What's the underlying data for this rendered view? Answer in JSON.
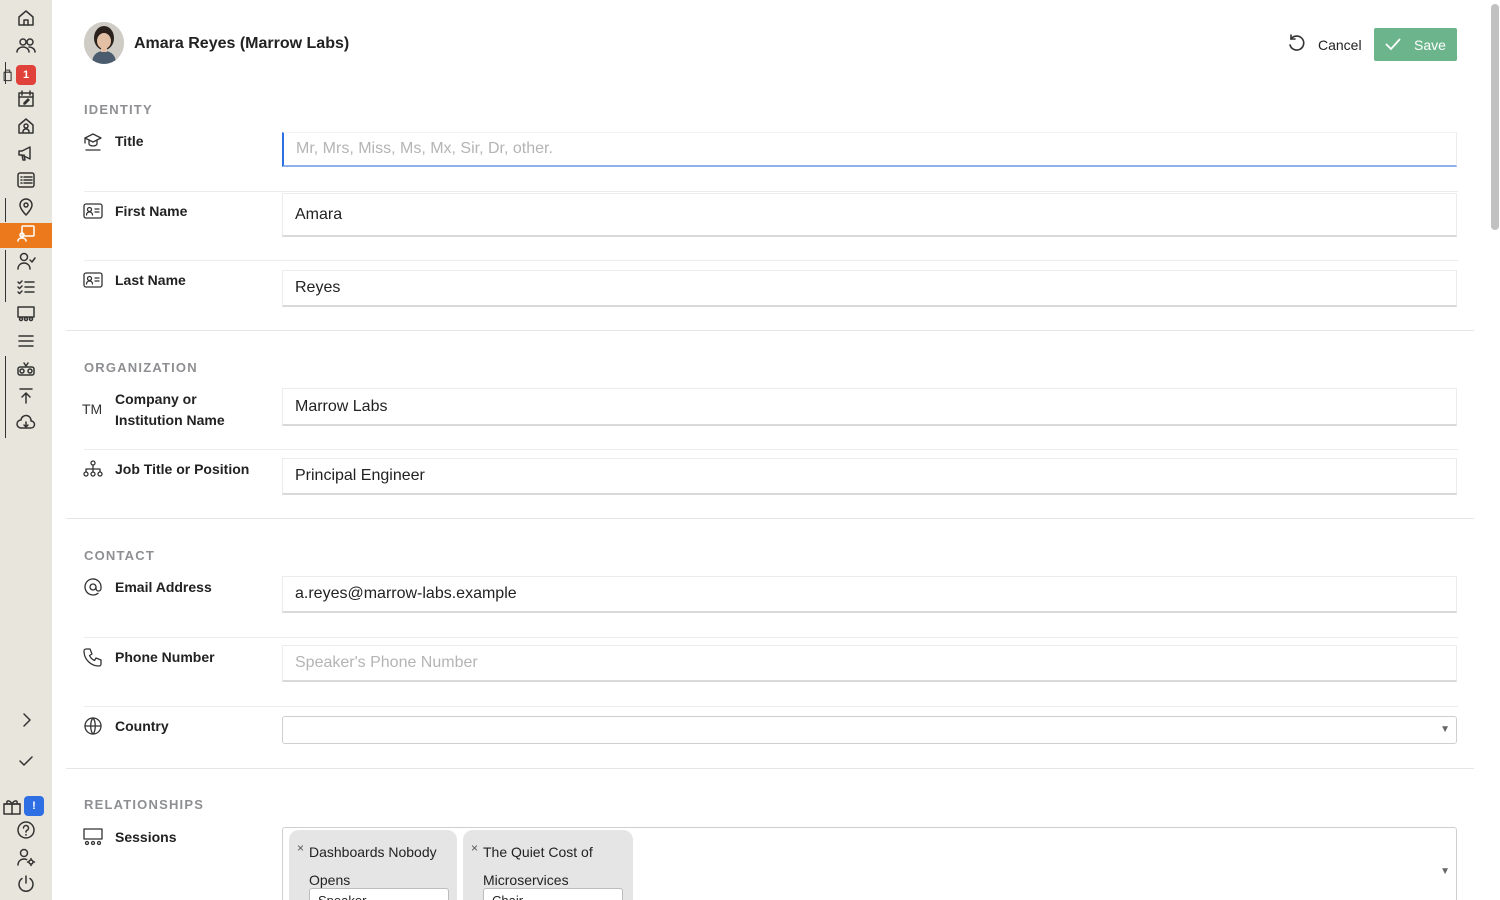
{
  "sidebar": {
    "items": [
      {
        "icon": "home-icon"
      },
      {
        "icon": "people-icon"
      },
      {
        "icon": "cart-icon",
        "badge": "1"
      },
      {
        "icon": "calendar-edit-icon"
      },
      {
        "icon": "venue-icon"
      },
      {
        "icon": "megaphone-icon"
      },
      {
        "icon": "list-icon"
      },
      {
        "icon": "location-pin-icon"
      },
      {
        "icon": "speaker-icon",
        "active": true
      },
      {
        "icon": "person-check-icon"
      },
      {
        "icon": "checklist-icon"
      },
      {
        "icon": "sessions-icon"
      },
      {
        "icon": "menu-lines-icon"
      },
      {
        "icon": "sponsor-icon"
      },
      {
        "icon": "upload-icon"
      },
      {
        "icon": "cloud-download-icon"
      }
    ],
    "bottom": [
      {
        "icon": "chevron-right-icon"
      },
      {
        "icon": "check-icon"
      },
      {
        "icon": "gift-icon",
        "badge": "!"
      },
      {
        "icon": "help-icon"
      },
      {
        "icon": "user-settings-icon"
      },
      {
        "icon": "power-icon"
      }
    ]
  },
  "header": {
    "name": "Amara Reyes (Marrow Labs)",
    "cancel_label": "Cancel",
    "save_label": "Save"
  },
  "sections": {
    "identity": "IDENTITY",
    "organization": "ORGANIZATION",
    "contact": "CONTACT",
    "relationships": "RELATIONSHIPS"
  },
  "fields": {
    "title": {
      "label": "Title",
      "value": "",
      "placeholder": "Mr, Mrs, Miss, Ms, Mx, Sir, Dr, other."
    },
    "first_name": {
      "label": "First Name",
      "value": "Amara"
    },
    "last_name": {
      "label": "Last Name",
      "value": "Reyes"
    },
    "company": {
      "label": "Company or Institution Name",
      "value": "Marrow Labs"
    },
    "job_title": {
      "label": "Job Title or Position",
      "value": "Principal Engineer"
    },
    "email": {
      "label": "Email Address",
      "value": "a.reyes@marrow-labs.example"
    },
    "phone": {
      "label": "Phone Number",
      "value": "",
      "placeholder": "Speaker's Phone Number"
    },
    "country": {
      "label": "Country",
      "value": ""
    },
    "sessions": {
      "label": "Sessions",
      "chips": [
        {
          "title": "Dashboards Nobody Opens",
          "role": "Speaker"
        },
        {
          "title": "The Quiet Cost of Microservices",
          "role": "Chair"
        }
      ]
    }
  },
  "colors": {
    "sidebar_bg": "#e8e6dc",
    "active_accent": "#ec7a1c",
    "save_button": "#6cb58c",
    "badge_red": "#e0413a",
    "badge_blue": "#2f6fe4"
  }
}
